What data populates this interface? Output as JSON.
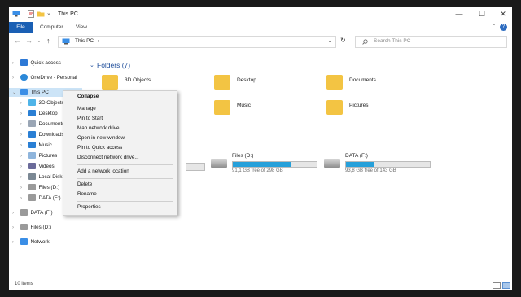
{
  "window": {
    "title": "This PC",
    "controls": {
      "minimize": "—",
      "maximize": "☐",
      "close": "✕"
    }
  },
  "ribbon": {
    "tabs": [
      "File",
      "Computer",
      "View"
    ],
    "help": "?",
    "collapse": "⌃"
  },
  "navigation": {
    "back": "←",
    "forward": "→",
    "recent": "⌄",
    "up": "↑",
    "address_path": [
      "This PC",
      "›"
    ],
    "address_dropdown": "⌄",
    "refresh": "↻",
    "search_placeholder": "Search This PC"
  },
  "sidebar": {
    "items": [
      {
        "label": "Quick access",
        "icon": "star-icon",
        "arrow": "›"
      },
      {
        "label": "OneDrive - Personal",
        "icon": "cloud-icon",
        "arrow": "›"
      },
      {
        "label": "This PC",
        "icon": "computer-icon",
        "arrow": "⌄",
        "selected": true
      },
      {
        "label": "3D Objects",
        "icon": "3d-objects-icon",
        "arrow": "›"
      },
      {
        "label": "Desktop",
        "icon": "desktop-icon",
        "arrow": "›"
      },
      {
        "label": "Documents",
        "icon": "documents-icon",
        "arrow": "›"
      },
      {
        "label": "Downloads",
        "icon": "downloads-icon",
        "arrow": "›"
      },
      {
        "label": "Music",
        "icon": "music-icon",
        "arrow": "›"
      },
      {
        "label": "Pictures",
        "icon": "pictures-icon",
        "arrow": "›"
      },
      {
        "label": "Videos",
        "icon": "videos-icon",
        "arrow": "›"
      },
      {
        "label": "Local Disk (C:)",
        "icon": "drive-icon",
        "arrow": "›"
      },
      {
        "label": "Files (D:)",
        "icon": "drive-icon",
        "arrow": "›"
      },
      {
        "label": "DATA (F:)",
        "icon": "drive-icon",
        "arrow": "›"
      },
      {
        "label": "DATA (F:)",
        "icon": "drive-icon",
        "arrow": "›"
      },
      {
        "label": "Files (D:)",
        "icon": "drive-icon",
        "arrow": "›"
      },
      {
        "label": "Network",
        "icon": "network-icon",
        "arrow": "›"
      }
    ]
  },
  "content": {
    "folders_title": "Folders (7)",
    "folders_arrow": "⌄",
    "folders": [
      {
        "label": "3D Objects",
        "icon": "3d-objects-icon"
      },
      {
        "label": "Desktop",
        "icon": "desktop-folder-icon"
      },
      {
        "label": "Documents",
        "icon": "documents-folder-icon"
      },
      {
        "label": "Music",
        "icon": "music-folder-icon"
      },
      {
        "label": "Pictures",
        "icon": "pictures-folder-icon"
      }
    ],
    "drives": [
      {
        "name": "Files (D:)",
        "free": "91,1 GB free of 298 GB",
        "used_fraction": 0.69
      },
      {
        "name": "DATA (F:)",
        "free": "93,8 GB free of 143 GB",
        "used_fraction": 0.34
      }
    ]
  },
  "context_menu": {
    "items": [
      {
        "label": "Collapse",
        "bold": true
      },
      {
        "label": "Manage"
      },
      {
        "label": "Pin to Start"
      },
      {
        "label": "Map network drive..."
      },
      {
        "label": "Open in new window"
      },
      {
        "label": "Pin to Quick access"
      },
      {
        "label": "Disconnect network drive..."
      },
      {
        "label": "Add a network location"
      },
      {
        "label": "Delete"
      },
      {
        "label": "Rename"
      },
      {
        "label": "Properties"
      }
    ]
  },
  "status": {
    "item_count": "10 items"
  },
  "colors": {
    "accent": "#1a5fb4",
    "selection": "#cce4f7",
    "drive_bar": "#26a0da",
    "folder": "#f3c443"
  }
}
